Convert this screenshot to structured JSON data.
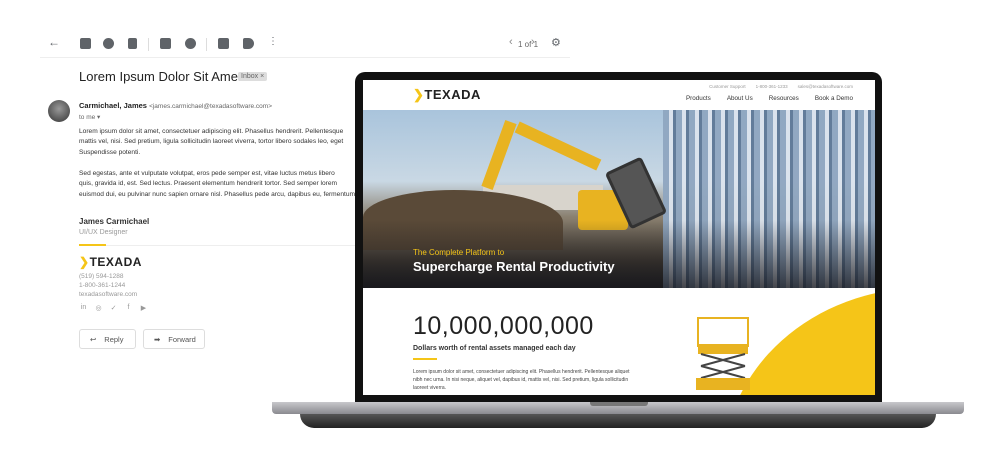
{
  "email": {
    "toolbar_icons": [
      "back-arrow-icon",
      "archive-icon",
      "report-spam-icon",
      "delete-icon",
      "mark-unread-icon",
      "snooze-icon",
      "move-to-icon",
      "label-icon",
      "more-icon"
    ],
    "pager": "1 of 1",
    "subject": "Lorem Ipsum Dolor Sit Amet",
    "badge": "Inbox ×",
    "sender_name": "Carmichael, James",
    "sender_email": "<james.carmichael@texadasoftware.com>",
    "to": "to me ▾",
    "body": [
      "Lorem ipsum dolor sit amet, consectetuer adipiscing elit. Phasellus hendrerit. Pellentesque",
      "mattis vel, nisi. Sed pretium, ligula sollicitudin laoreet viverra, tortor libero sodales leo, eget",
      "Suspendisse potenti.",
      "Sed egestas, ante et vulputate volutpat, eros pede semper est, vitae luctus metus libero",
      "quis, gravida id, est. Sed lectus. Praesent elementum hendrerit tortor. Sed semper lorem",
      "euismod dui, eu pulvinar nunc sapien ornare nisl. Phasellus pede arcu, dapibus eu, fermentum"
    ],
    "signature": {
      "name": "James Carmichael",
      "title": "UI/UX Designer",
      "logo": "TEXADA",
      "phone": "(519) 594-1288",
      "tollfree": "1-800-361-1244",
      "website": "texadasoftware.com",
      "social": [
        "in",
        "◎",
        "🐦",
        "f",
        "▶"
      ]
    },
    "reply_label": "Reply",
    "forward_label": "Forward"
  },
  "website": {
    "logo": "TEXADA",
    "top_links": [
      "Customer Support",
      "1-800-361-1233",
      "sales@texadasoftware.com"
    ],
    "menu": [
      "Products",
      "About Us",
      "Resources",
      "Book a Demo"
    ],
    "hero_subtitle": "The Complete Platform to",
    "hero_title": "Supercharge Rental Productivity",
    "stat_number": "10,000,000,000",
    "stat_label": "Dollars worth of rental assets managed each day",
    "stat_text": "Lorem ipsum dolor sit amet, consectetuer adipiscing elit. Phasellus hendrerit. Pellentesque aliquet nibh nec urna. In nisi neque, aliquet vel, dapibus id, mattis vel, nisi. Sed pretium, ligula sollicitudin laoreet viverra.",
    "accent": "#f5c518"
  }
}
